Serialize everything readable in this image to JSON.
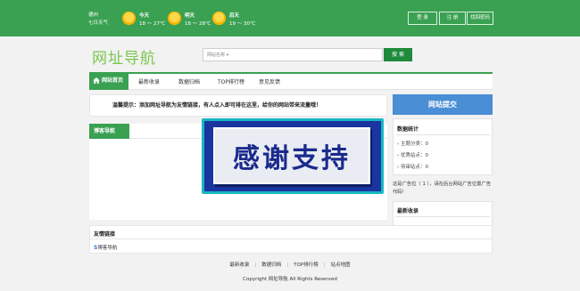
{
  "weather": {
    "city": "德州",
    "week": "七日天气",
    "days": [
      {
        "label": "今天",
        "temp": "18 ～ 27℃",
        "icon": "sun-icon"
      },
      {
        "label": "明天",
        "temp": "18 ～ 28℃",
        "icon": "sun-icon"
      },
      {
        "label": "后天",
        "temp": "19 ～ 30℃",
        "icon": "sun-icon"
      }
    ]
  },
  "top_buttons": {
    "login": "登 录",
    "register": "注 册",
    "forgot": "找回密码"
  },
  "logo": "网址导航",
  "search": {
    "select": "网站名称",
    "placeholder": "",
    "button": "搜 索"
  },
  "nav": {
    "home": "网站首页",
    "items": [
      "最新收录",
      "数据归档",
      "TOP排行榜",
      "意见反馈"
    ]
  },
  "notice": "温馨提示：添加网址导航为友情链接，有人点入即可排在这里，给你的网站带来流量哦！",
  "panel": {
    "tab": "博客导航"
  },
  "ad_banner": "感谢支持",
  "submit": "网站提交",
  "stats": {
    "title": "数据统计",
    "rows": [
      "主题分类：0",
      "优秀站点：0",
      "待审站点：0"
    ]
  },
  "ad_spot": "这是广告位（ 1 ），请在后台网站广告位置广告代码!",
  "recent": {
    "title": "最新收录"
  },
  "links": {
    "title": "友情链接",
    "item_icon": "S",
    "item": "博客导航"
  },
  "footer": {
    "nav": [
      "最新收录",
      "数据归档",
      "TOP排行榜",
      "站点地图"
    ],
    "copyright": "Copyright 网址导航 All Rights Reserved"
  },
  "colors": {
    "brand": "#3aa152",
    "submit": "#4a8ed6",
    "logo": "#7ac74f"
  }
}
